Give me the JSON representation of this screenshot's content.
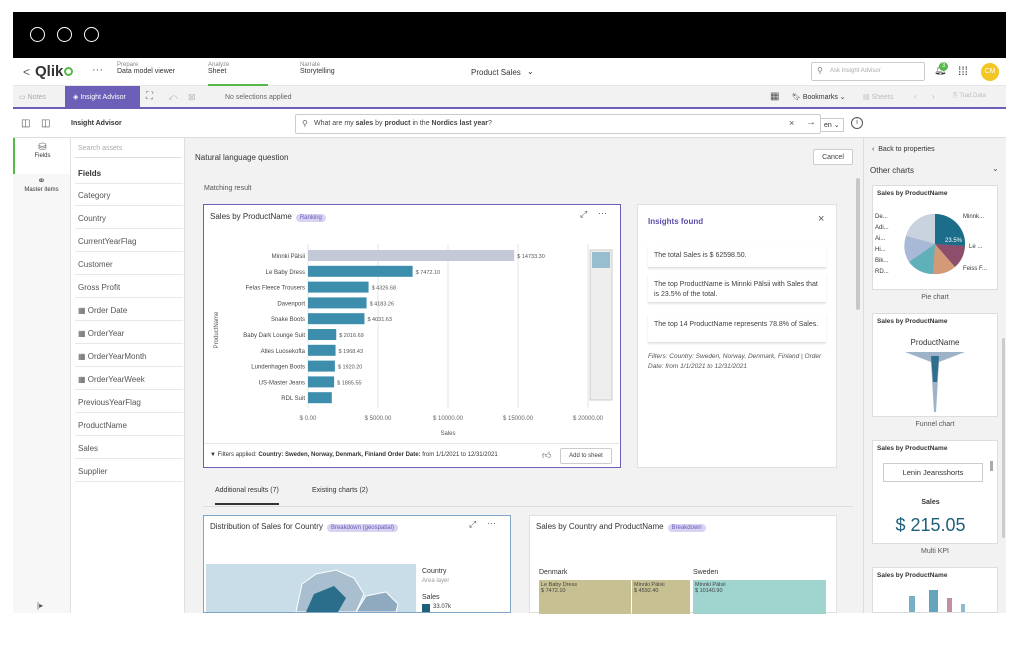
{
  "header": {
    "back": "<",
    "logo": "Qlik",
    "more": "···",
    "nav": [
      {
        "small": "Prepare",
        "big": "Data model viewer"
      },
      {
        "small": "Analyze",
        "big": "Sheet"
      },
      {
        "small": "Narrate",
        "big": "Storytelling"
      }
    ],
    "app_title": "Product Sales",
    "search_placeholder": "Ask Insight Advisor",
    "notif_count": "3",
    "avatar": "CM"
  },
  "toolbar": {
    "notes": "Notes",
    "insight_advisor": "Insight Advisor",
    "no_selections": "No selections applied",
    "bookmarks": "Bookmarks",
    "sheets": "Sheets",
    "tracking": "Trad.Data"
  },
  "searchbar": {
    "title": "Insight Advisor",
    "query_pre": "What are my ",
    "query_b1": "sales",
    "query_mid1": " by ",
    "query_b2": "product",
    "query_mid2": " in the ",
    "query_b3": "Nordics last year",
    "query_post": "?",
    "lang": "en"
  },
  "rail": {
    "fields": "Fields",
    "master_items": "Master items"
  },
  "assets": {
    "search_placeholder": "Search assets",
    "header": "Fields",
    "items": [
      "Category",
      "Country",
      "CurrentYearFlag",
      "Customer",
      "Gross Profit",
      "Order Date",
      "OrderYear",
      "OrderYearMonth",
      "OrderYearWeek",
      "PreviousYearFlag",
      "ProductName",
      "Sales",
      "Supplier"
    ]
  },
  "main": {
    "nlq_title": "Natural language question",
    "cancel": "Cancel",
    "matching": "Matching result",
    "chart_title": "Sales by ProductName",
    "chart_badge": "Ranking",
    "filters_label": "Filters applied:",
    "filters_text": "Country: Sweden, Norway, Denmark, Finland",
    "filters_date_label": "Order Date:",
    "filters_date": "from 1/1/2021 to 12/31/2021",
    "add_to_sheet": "Add to sheet",
    "tab_additional": "Additional results (7)",
    "tab_existing": "Existing charts (2)",
    "dist_title": "Distribution of Sales for Country",
    "dist_badge": "Breakdown (geospatial)",
    "legend_country": "Country",
    "legend_area": "Area layer",
    "legend_sales": "Sales",
    "legend_value": "33.07k",
    "bd_title": "Sales by Country and ProductName",
    "bd_badge": "Breakdown",
    "bd_denmark": "Denmark",
    "bd_sweden": "Sweden",
    "bd_cells": [
      {
        "name": "Le Baby Dress",
        "val": "$ 7472.10"
      },
      {
        "name": "Minnki Pälsii",
        "val": "$ 4592.40"
      },
      {
        "name": "Minnki Pälsii",
        "val": "$ 10140.90"
      }
    ]
  },
  "insights": {
    "title": "Insights found",
    "items": [
      "The total Sales is $ 62598.50.",
      "The top ProductName is Minnki Pälsii with Sales that is 23.5% of the total.",
      "The top 14 ProductName represents 78.8% of Sales."
    ],
    "filters": "Filters: Country: Sweden, Norway, Denmark, Finland | Order Date: from 1/1/2021 to 12/31/2021"
  },
  "right": {
    "back": "Back to properties",
    "other_charts": "Other charts",
    "pie_title": "Sales by ProductName",
    "pie_labels": [
      "De...",
      "Adi...",
      "Ai...",
      "Hi...",
      "Bik...",
      "RD..."
    ],
    "pie_right_labels": [
      "Minnk...",
      "Le ...",
      "Feiss F..."
    ],
    "pie_pct": "23.5%",
    "pie_label": "Pie chart",
    "funnel_title": "Sales by ProductName",
    "funnel_head": "ProductName",
    "funnel_label": "Funnel chart",
    "kpi_title": "Sales by ProductName",
    "kpi_name": "Lenin Jeansshorts",
    "kpi_measure": "Sales",
    "kpi_value": "$ 215.05",
    "kpi_label": "Multi KPI",
    "wc_title": "Sales by ProductName"
  },
  "colors": {
    "accent": "#6c5fb8",
    "bar": "#3d8ead",
    "bar_top": "#c3c9d6",
    "qlik_green": "#54b948"
  },
  "chart_data": {
    "type": "bar",
    "orientation": "horizontal",
    "title": "Sales by ProductName",
    "xlabel": "Sales",
    "ylabel": "ProductName",
    "categories": [
      "Minnki Pälsii",
      "Le Baby Dress",
      "Felas Fleece Trousers",
      "Davenport",
      "Snake Boots",
      "Baby Dark Lounge Suit",
      "Atles Luosekofta",
      "Lundenhagen Boots",
      "US-Master Jeans",
      "RDL Suit"
    ],
    "values": [
      14733.3,
      7472.1,
      4326.68,
      4183.26,
      4031.63,
      2016.69,
      1968.43,
      1920.2,
      1865.55,
      1700
    ],
    "value_labels": [
      "$ 14733.30",
      "$ 7472.10",
      "$ 4326.68",
      "$ 4183.26",
      "$ 4031.63",
      "$ 2016.69",
      "$ 1968.43",
      "$ 1920.20",
      "$ 1865.55",
      ""
    ],
    "xticks": [
      "$ 0.00",
      "$ 5000.00",
      "$ 10000.00",
      "$ 15000.00",
      "$ 20000.00"
    ],
    "xlim": [
      0,
      20000
    ],
    "grid": true
  }
}
